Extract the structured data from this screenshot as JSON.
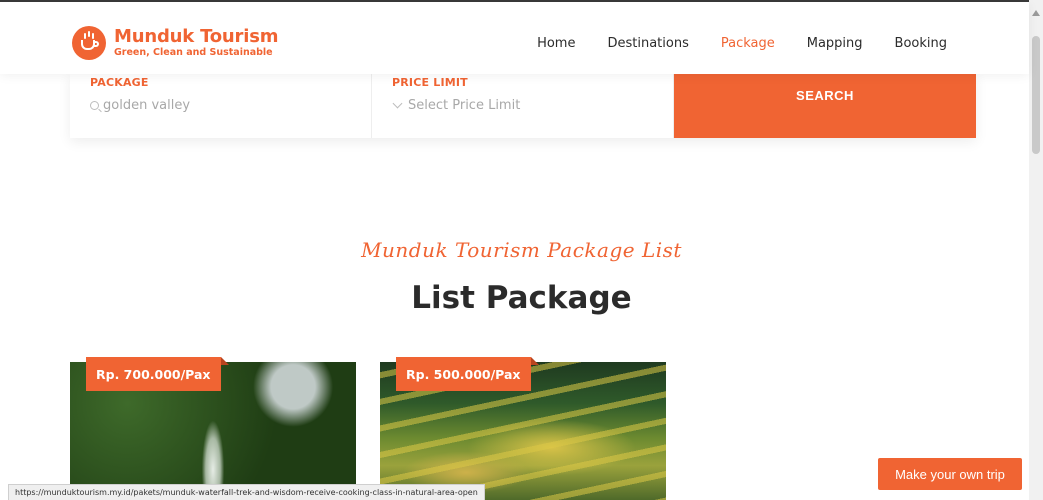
{
  "brand": {
    "name": "Munduk Tourism",
    "tagline": "Green, Clean and Sustainable",
    "accent_color": "#f06433"
  },
  "nav": {
    "items": [
      {
        "label": "Home",
        "active": false
      },
      {
        "label": "Destinations",
        "active": false
      },
      {
        "label": "Package",
        "active": true
      },
      {
        "label": "Mapping",
        "active": false
      },
      {
        "label": "Booking",
        "active": false
      }
    ]
  },
  "search": {
    "package_label": "PACKAGE",
    "package_value": "golden valley",
    "price_label": "PRICE LIMIT",
    "price_placeholder": "Select Price Limit",
    "button_label": "SEARCH"
  },
  "section": {
    "script_title": "Munduk Tourism Package List",
    "title": "List Package"
  },
  "cards": [
    {
      "price": "Rp. 700.000/Pax",
      "image": "waterfall-photo"
    },
    {
      "price": "Rp. 500.000/Pax",
      "image": "rice-terraces-photo"
    }
  ],
  "status_url": "https://munduktourism.my.id/pakets/munduk-waterfall-trek-and-wisdom-receive-cooking-class-in-natural-area-open",
  "make_trip_label": "Make your own trip"
}
